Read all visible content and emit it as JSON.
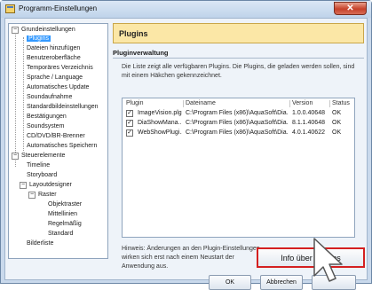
{
  "window": {
    "title": "Programm-Einstellungen",
    "close_glyph": "✕"
  },
  "tree": {
    "root1": "Grundeinstellungen",
    "items1": [
      "Plugins",
      "Dateien hinzufügen",
      "Benutzeroberfläche",
      "Temporäres Verzeichnis",
      "Sprache / Language",
      "Automatisches Update",
      "Soundaufnahme",
      "Standardbildeinstellungen",
      "Bestätigungen",
      "Soundsystem",
      "CD/DVD/BR-Brenner",
      "Automatisches Speichern"
    ],
    "root2": "Steuerelemente",
    "items2": [
      "Timeline",
      "Storyboard"
    ],
    "layout": "Layoutdesigner",
    "raster": "Raster",
    "raster_items": [
      "Objektraster",
      "Mittellinien",
      "Regelmäßig",
      "Standard"
    ],
    "bilderliste": "Bilderliste",
    "expander_minus": "−"
  },
  "header": {
    "title": "Plugins"
  },
  "section": {
    "title": "Pluginverwaltung"
  },
  "description": "Die Liste zeigt alle verfügbaren Plugins. Die Plugins, die geladen werden sollen, sind mit einem Häkchen gekennzeichnet.",
  "table": {
    "columns": [
      "Plugin",
      "Dateiname",
      "Version",
      "Status"
    ],
    "rows": [
      {
        "plugin": "ImageVision.plg",
        "file": "C:\\Program Files (x86)\\AquaSoft\\Dia...",
        "version": "1.0.0.40648",
        "status": "OK",
        "checked": "✓"
      },
      {
        "plugin": "DiaShowMana...",
        "file": "C:\\Program Files (x86)\\AquaSoft\\Dia...",
        "version": "8.1.1.40648",
        "status": "OK",
        "checked": "✓"
      },
      {
        "plugin": "WebShowPlugi...",
        "file": "C:\\Program Files (x86)\\AquaSoft\\Dia...",
        "version": "4.0.1.40622",
        "status": "OK",
        "checked": "✓"
      }
    ]
  },
  "note": "Hinweis: Änderungen an den Plugin-Einstellungen wirken sich erst nach einem Neustart der Anwendung aus.",
  "buttons": {
    "info": "Info über Plugins",
    "ok": "OK",
    "cancel": "Abbrechen",
    "help": ""
  },
  "colors": {
    "highlight": "#d42020",
    "header_bg": "#fbe7a6",
    "selection": "#3399ff"
  }
}
